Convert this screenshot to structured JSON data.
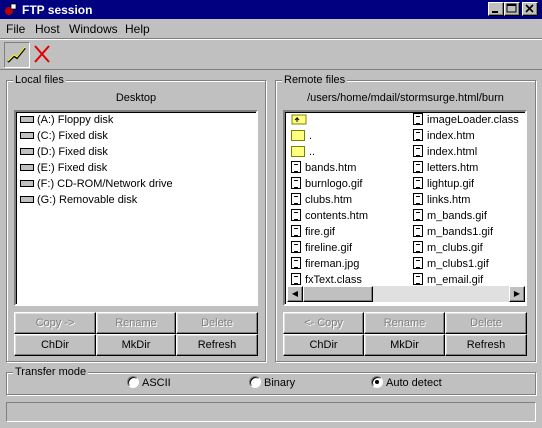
{
  "window": {
    "title": "FTP session"
  },
  "menu": {
    "file": "File",
    "host": "Host",
    "windows": "Windows",
    "help": "Help"
  },
  "local": {
    "label": "Local files",
    "path": "Desktop",
    "drives": [
      "(A:) Floppy disk",
      "(C:) Fixed disk",
      "(D:) Fixed disk",
      "(E:) Fixed disk",
      "(F:) CD-ROM/Network drive",
      "(G:) Removable disk"
    ],
    "buttons": {
      "copy": "Copy ->",
      "rename": "Rename",
      "delete": "Delete",
      "chdir": "ChDir",
      "mkdir": "MkDir",
      "refresh": "Refresh"
    }
  },
  "remote": {
    "label": "Remote files",
    "path": "/users/home/mdail/stormsurge.html/burn",
    "col1": [
      ".",
      "..",
      "bands.htm",
      "burnlogo.gif",
      "clubs.htm",
      "contents.htm",
      "fire.gif",
      "fireline.gif",
      "fireman.jpg",
      "fxText.class"
    ],
    "col2": [
      "imageLoader.class",
      "index.htm",
      "index.html",
      "letters.htm",
      "lightup.gif",
      "links.htm",
      "m_bands.gif",
      "m_bands1.gif",
      "m_clubs.gif",
      "m_clubs1.gif",
      "m_email.gif"
    ],
    "buttons": {
      "copy": "<- Copy",
      "rename": "Rename",
      "delete": "Delete",
      "chdir": "ChDir",
      "mkdir": "MkDir",
      "refresh": "Refresh"
    }
  },
  "transfer": {
    "label": "Transfer mode",
    "ascii": "ASCII",
    "binary": "Binary",
    "auto": "Auto detect",
    "selected": "Auto detect"
  },
  "status": {
    "text": ""
  },
  "colors": {
    "titlebar": "#000080",
    "face": "#c0c0c0"
  }
}
